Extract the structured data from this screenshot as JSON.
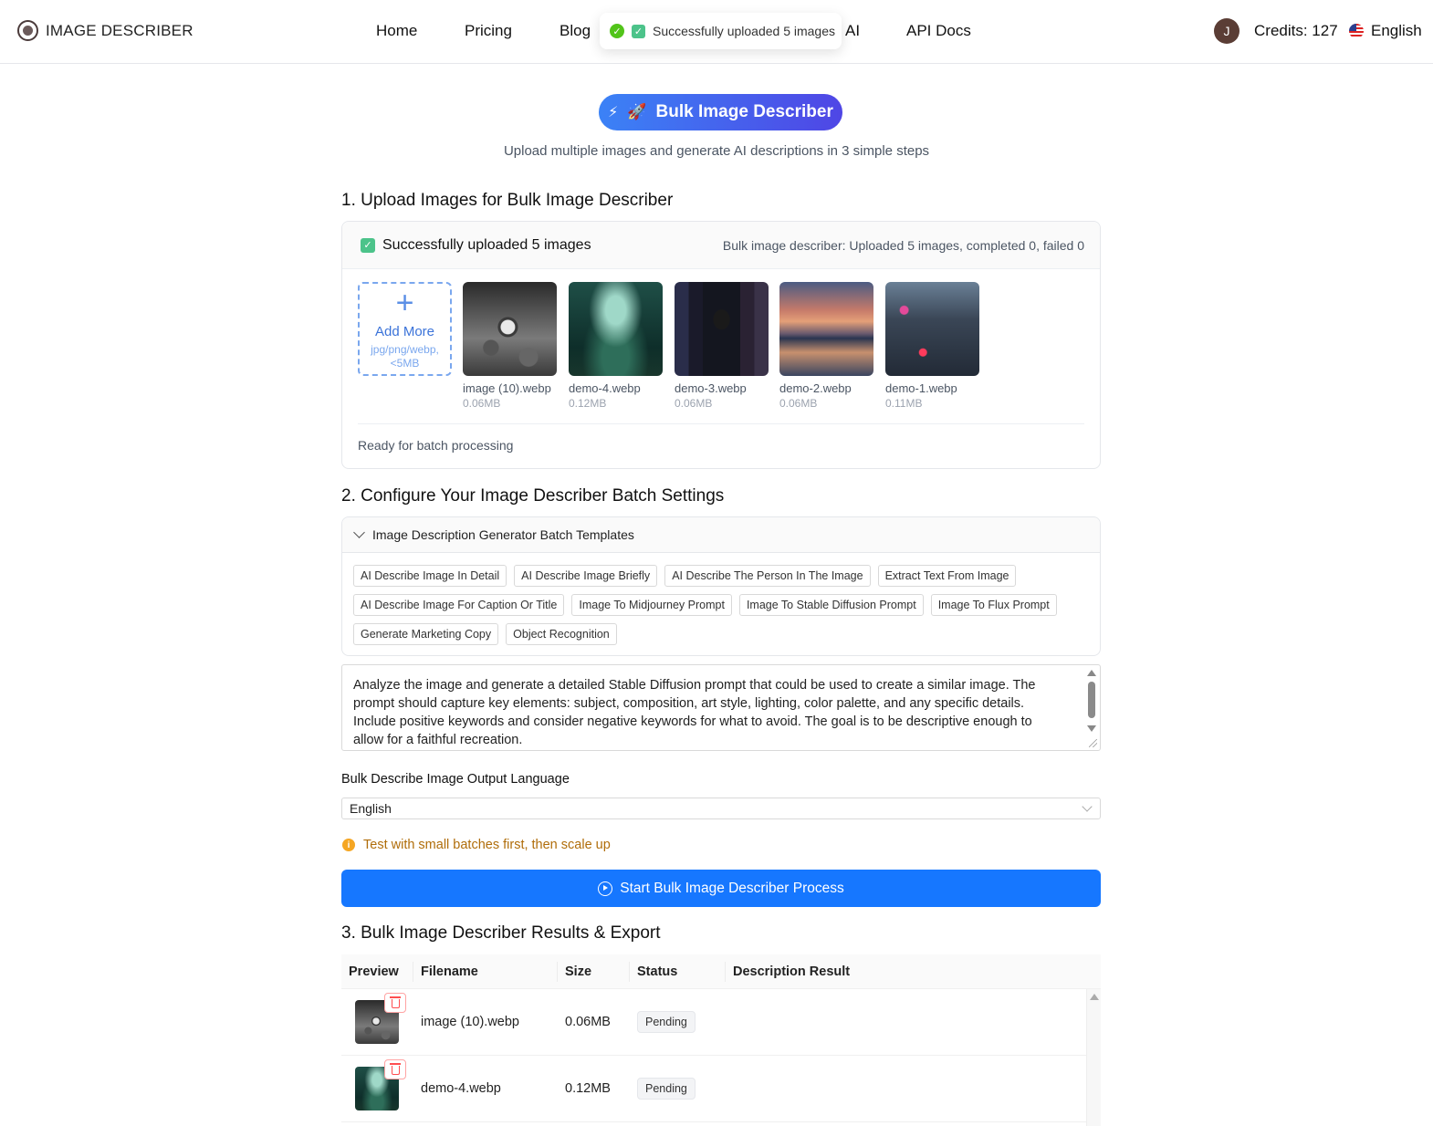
{
  "header": {
    "logo_text": "IMAGE DESCRIBER",
    "nav": [
      "Home",
      "Pricing",
      "Blog",
      "AI",
      "API Docs"
    ],
    "toast": "Successfully uploaded 5 images",
    "avatar_initial": "J",
    "credits": "Credits: 127",
    "language": "English"
  },
  "hero": {
    "button_label": "Bulk Image Describer",
    "rocket": "🚀",
    "subtitle": "Upload multiple images and generate AI descriptions in 3 simple steps"
  },
  "section1": {
    "title": "1. Upload Images for Bulk Image Describer",
    "status": "Successfully uploaded 5 images",
    "summary": "Bulk image describer: Uploaded 5 images, completed 0, failed 0",
    "add_more_label": "Add More",
    "add_more_hint": "jpg/png/webp, <5MB",
    "images": [
      {
        "name": "image (10).webp",
        "size": "0.06MB"
      },
      {
        "name": "demo-4.webp",
        "size": "0.12MB"
      },
      {
        "name": "demo-3.webp",
        "size": "0.06MB"
      },
      {
        "name": "demo-2.webp",
        "size": "0.06MB"
      },
      {
        "name": "demo-1.webp",
        "size": "0.11MB"
      }
    ],
    "ready_text": "Ready for batch processing"
  },
  "section2": {
    "title": "2. Configure Your Image Describer Batch Settings",
    "templates_header": "Image Description Generator Batch Templates",
    "templates": [
      "AI Describe Image In Detail",
      "AI Describe Image Briefly",
      "AI Describe The Person In The Image",
      "Extract Text From Image",
      "AI Describe Image For Caption Or Title",
      "Image To Midjourney Prompt",
      "Image To Stable Diffusion Prompt",
      "Image To Flux Prompt",
      "Generate Marketing Copy",
      "Object Recognition"
    ],
    "prompt": "Analyze the image and generate a detailed Stable Diffusion prompt that could be used to create a similar image. The prompt should capture key elements: subject, composition, art style, lighting, color palette, and any specific details. Include positive keywords and consider negative keywords for what to avoid. The goal is to be descriptive enough to allow for a faithful recreation.",
    "language_label": "Bulk Describe Image Output Language",
    "language_value": "English",
    "tip": "Test with small batches first, then scale up",
    "start_button": "Start Bulk Image Describer Process"
  },
  "section3": {
    "title": "3. Bulk Image Describer Results & Export",
    "columns": [
      "Preview",
      "Filename",
      "Size",
      "Status",
      "Description Result"
    ],
    "rows": [
      {
        "filename": "image (10).webp",
        "size": "0.06MB",
        "status": "Pending",
        "description": ""
      },
      {
        "filename": "demo-4.webp",
        "size": "0.12MB",
        "status": "Pending",
        "description": ""
      }
    ]
  },
  "icons": {
    "logo": "logo-icon",
    "toast": "check-circle-icon",
    "hero": "lightning-icon",
    "add": "plus-icon",
    "templates": "chevron-down-icon",
    "tip": "info-icon",
    "start": "play-circle-icon",
    "delete": "trash-icon"
  },
  "colors": {
    "primary": "#1677ff",
    "hero_gradient_start": "#3b82f6",
    "hero_gradient_end": "#4f46e5",
    "success": "#52c41a",
    "warning": "#b06d0a",
    "danger": "#ff4d4f"
  }
}
